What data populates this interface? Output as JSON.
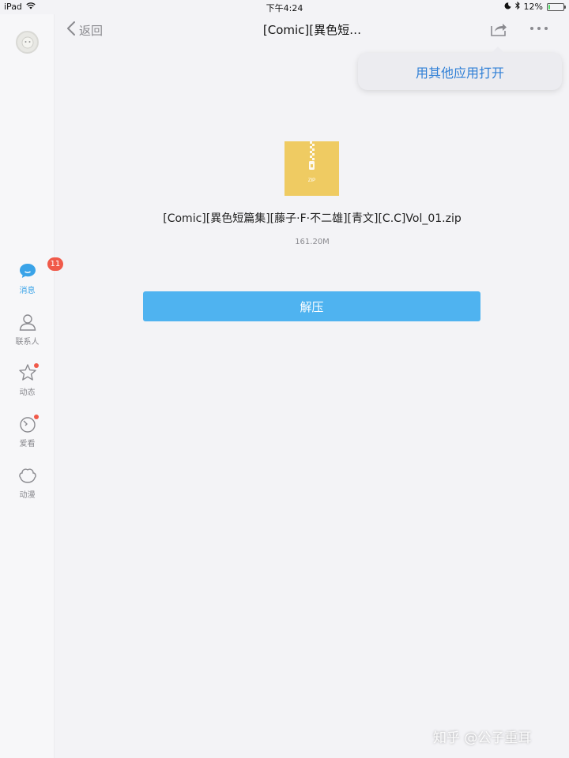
{
  "status_bar": {
    "device": "iPad",
    "time": "下午4:24",
    "battery": "12%",
    "battery_level": 0.12
  },
  "sidebar": {
    "items": [
      {
        "label": "消息",
        "badge": "11",
        "icon": "message-icon",
        "active": true
      },
      {
        "label": "联系人",
        "icon": "contacts-icon"
      },
      {
        "label": "动态",
        "icon": "star-icon",
        "dot": true
      },
      {
        "label": "爱看",
        "icon": "watch-icon",
        "dot": true
      },
      {
        "label": "动漫",
        "icon": "comic-icon"
      }
    ]
  },
  "header": {
    "back_label": "返回",
    "title": "[Comic][異色短…"
  },
  "popover": {
    "open_with_label": "用其他应用打开"
  },
  "file": {
    "icon_label": "ZIP",
    "name": "[Comic][異色短篇集][藤子·F·不二雄][青文][C.C]Vol_01.zip",
    "size": "161.20M"
  },
  "actions": {
    "extract_label": "解压"
  },
  "watermark": "知乎 @公子重耳",
  "colors": {
    "accent": "#4fb3f0",
    "link": "#2f7fd6",
    "badge": "#f05a4a",
    "zip": "#efcb62"
  }
}
